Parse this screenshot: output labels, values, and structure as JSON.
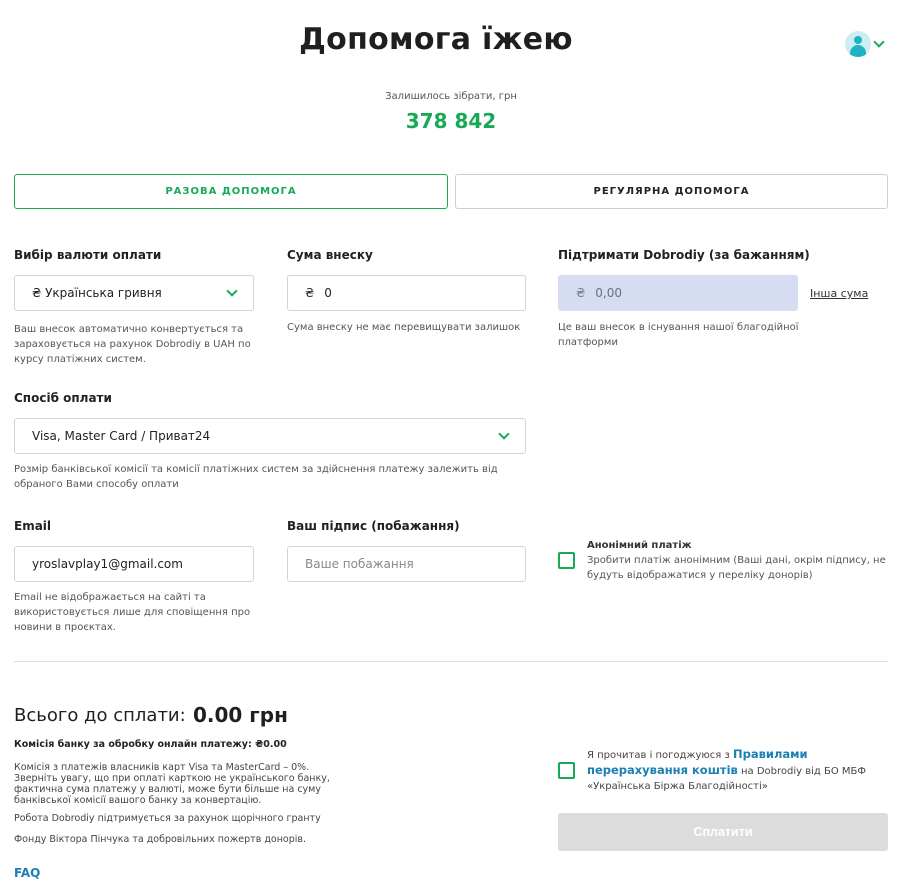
{
  "header": {
    "title": "Допомога їжею",
    "remaining_label": "Залишилось зібрати, грн",
    "remaining_value": "378 842"
  },
  "tabs": [
    {
      "label": "РАЗОВА ДОПОМОГА",
      "active": true
    },
    {
      "label": "РЕГУЛЯРНА ДОПОМОГА",
      "active": false
    }
  ],
  "currency": {
    "label": "Вибір валюти оплати",
    "selected": "₴ Українська гривня",
    "help": "Ваш внесок автоматично конвертується та зараховується на рахунок Dobrodiy в UAH по курсу платіжних систем."
  },
  "amount": {
    "label": "Сума внеску",
    "currency_symbol": "₴",
    "value": "0",
    "help": "Сума внеску не має перевищувати залишок"
  },
  "support": {
    "label": "Підтримати Dobrodiy (за бажанням)",
    "currency_symbol": "₴",
    "value": "0,00",
    "other_amount": "Інша сума",
    "help": "Це ваш внесок в існування нашої благодійної платформи"
  },
  "payment_method": {
    "label": "Спосіб оплати",
    "selected": "Visa, Master Card / Приват24",
    "help": "Розмір банківської комісії та комісії платіжних систем за здійснення платежу залежить від обраного Вами способу оплати"
  },
  "email": {
    "label": "Email",
    "value": "yroslavplay1@gmail.com",
    "help": "Email не відображається на сайті та використовується лише для сповіщення про новини в проєктах."
  },
  "signature": {
    "label": "Ваш підпис (побажання)",
    "placeholder": "Ваше побажання"
  },
  "anonymous": {
    "title": "Анонімний платіж",
    "text": "Зробити платіж анонімним (Ваші дані, окрім підпису, не будуть відображатися у переліку донорів)"
  },
  "summary": {
    "total_label": "Всього до сплати:",
    "total_value": "0.00 грн",
    "bank_fee": "Комісія банку за обробку онлайн платежу: ₴0.00",
    "fee_note": "Комісія з платежів власників карт Visa та MasterCard – 0%. Зверніть увагу, що при оплаті карткою не українського банку, фактична сума платежу у валюті, може бути більше на суму банківської комісії вашого банку за конвертацію.",
    "grant_note": "Робота Dobrodiy підтримується за рахунок щорічного гранту",
    "fund_note": "Фонду Віктора Пінчука та добровільних пожертв донорів.",
    "faq": "FAQ"
  },
  "agreement": {
    "prefix": "Я прочитав і погоджуюся з",
    "rules_link": "Правилами перерахування коштів",
    "suffix": "на Dobrodiy від БО МБФ «Українська Біржа Благодійності»"
  },
  "pay_button": "Сплатити"
}
